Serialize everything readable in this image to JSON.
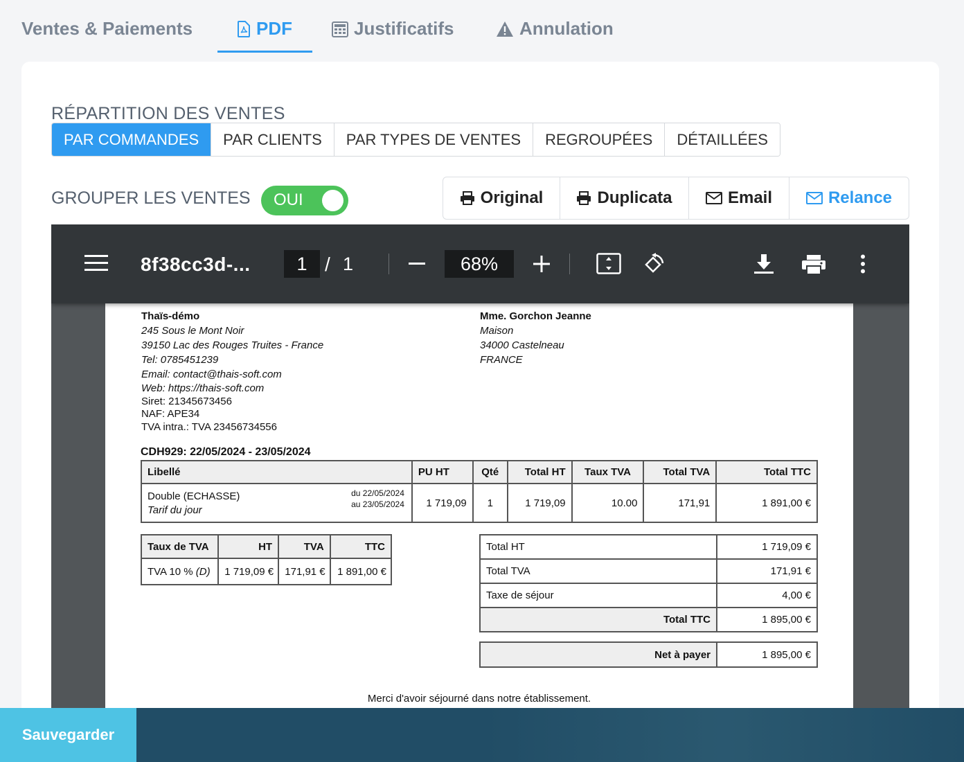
{
  "tabs": [
    {
      "label": "Ventes & Paiements"
    },
    {
      "label": "PDF"
    },
    {
      "label": "Justificatifs"
    },
    {
      "label": "Annulation"
    }
  ],
  "repartition": {
    "title": "RÉPARTITION DES VENTES",
    "options": [
      "PAR COMMANDES",
      "PAR CLIENTS",
      "PAR TYPES DE VENTES",
      "REGROUPÉES",
      "DÉTAILLÉES"
    ],
    "selected": "PAR COMMANDES"
  },
  "group": {
    "label": "GROUPER LES VENTES",
    "toggle_label": "OUI"
  },
  "actions": {
    "original": "Original",
    "duplicata": "Duplicata",
    "email": "Email",
    "relance": "Relance"
  },
  "viewer": {
    "title": "8f38cc3d-...",
    "page_current": "1",
    "page_sep": "/",
    "page_total": "1",
    "zoom": "68%"
  },
  "invoice": {
    "sender": {
      "name": "Thaïs-démo",
      "address1": "245 Sous le Mont Noir",
      "address2": "39150 Lac des Rouges Truites - France",
      "tel": "Tel: 0785451239",
      "email": "Email: contact@thais-soft.com",
      "web": "Web: https://thais-soft.com",
      "siret": "Siret: 21345673456",
      "naf": "NAF: APE34",
      "tva": "TVA intra.: TVA 23456734556"
    },
    "recipient": {
      "name": "Mme. Gorchon Jeanne",
      "line1": "Maison",
      "line2": "34000 Castelneau",
      "line3": "FRANCE"
    },
    "order": "CDH929: 22/05/2024 - 23/05/2024",
    "lines_header": [
      "Libellé",
      "PU HT",
      "Qté",
      "Total HT",
      "Taux TVA",
      "Total TVA",
      "Total TTC"
    ],
    "line": {
      "label": "Double (ECHASSE)",
      "sublabel": "Tarif du jour",
      "date_from": "du 22/05/2024",
      "date_to": "au 23/05/2024",
      "pu_ht": "1 719,09",
      "qty": "1",
      "total_ht": "1 719,09",
      "taux_tva": "10.00",
      "total_tva": "171,91",
      "total_ttc": "1 891,00 €"
    },
    "vat_header": [
      "Taux de TVA",
      "HT",
      "TVA",
      "TTC"
    ],
    "vat_row": {
      "rate": "TVA 10 %",
      "code": "(D)",
      "ht": "1 719,09 €",
      "tva": "171,91 €",
      "ttc": "1 891,00 €"
    },
    "totals": [
      {
        "label": "Total HT",
        "value": "1 719,09 €"
      },
      {
        "label": "Total TVA",
        "value": "171,91 €"
      },
      {
        "label": "Taxe de séjour",
        "value": "4,00 €"
      },
      {
        "label": "Total TTC",
        "value": "1 895,00 €"
      }
    ],
    "net": {
      "label": "Net à payer",
      "value": "1 895,00 €"
    },
    "footer": "Merci d'avoir séjourné dans notre établissement."
  },
  "save_label": "Sauvegarder"
}
